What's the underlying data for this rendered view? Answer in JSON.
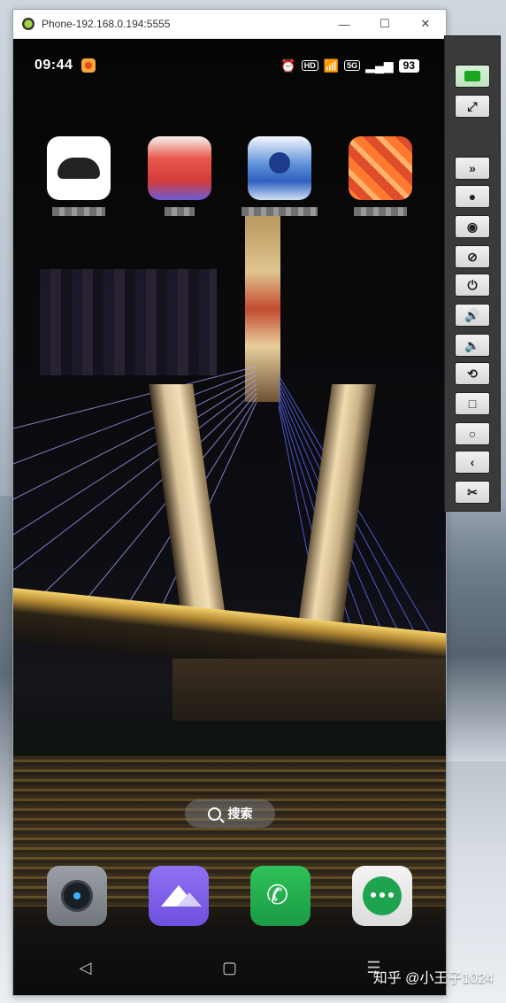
{
  "window": {
    "title": "Phone-192.168.0.194:5555",
    "controls": {
      "minimize": "—",
      "maximize": "☐",
      "close": "✕"
    }
  },
  "status_bar": {
    "time": "09:44",
    "battery": "93",
    "hd_label": "HD",
    "signal_5g": "5G"
  },
  "home": {
    "search_label": "搜索"
  },
  "toolbar": {
    "icons": [
      "screen-icon",
      "fullscreen-icon",
      "collapse-icon",
      "record-icon",
      "eye-icon",
      "eye-off-icon",
      "power-icon",
      "volume-up-icon",
      "volume-down-icon",
      "rotate-icon",
      "square-icon",
      "home-circle-icon",
      "back-icon",
      "scissors-icon"
    ]
  },
  "watermark": "知乎 @小王子1024"
}
